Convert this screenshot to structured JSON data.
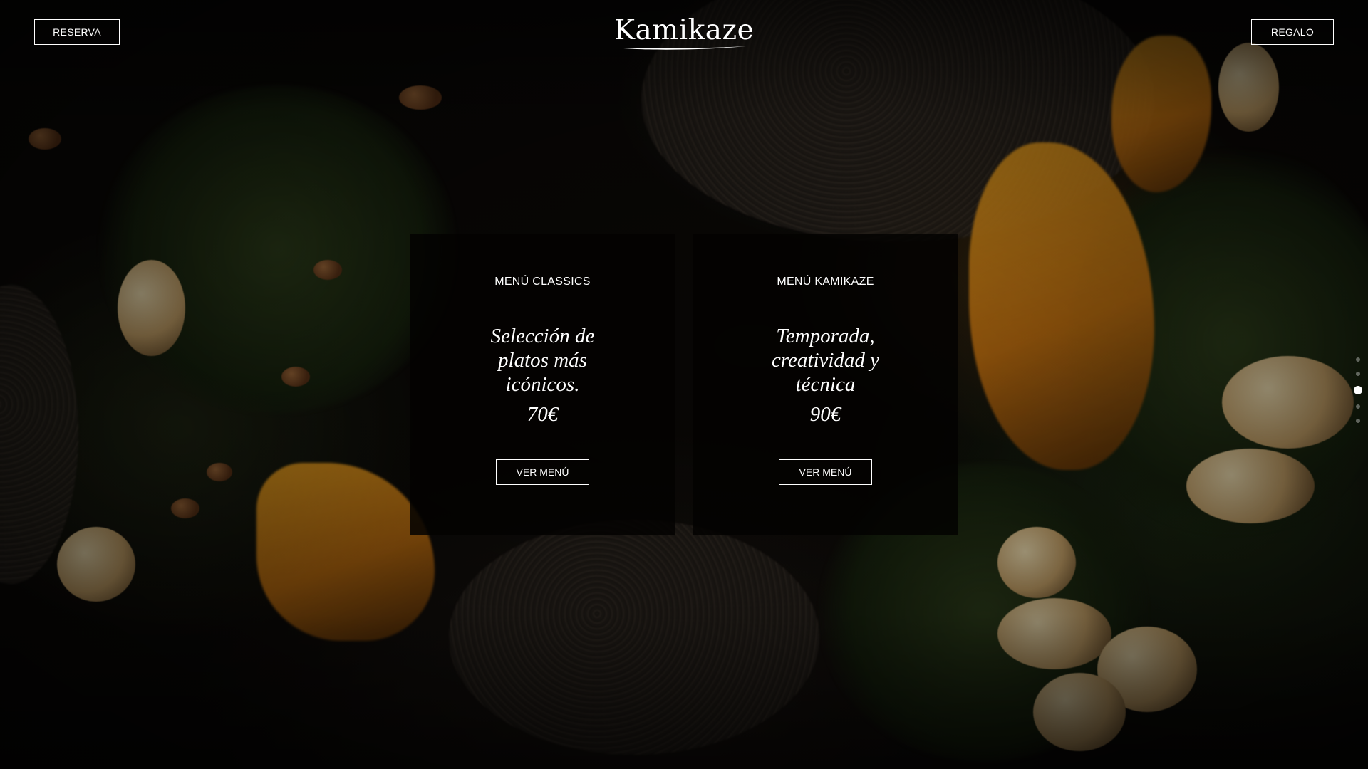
{
  "header": {
    "reserva_label": "RESERVA",
    "regalo_label": "REGALO",
    "logo_text": "Kamikaze"
  },
  "menus": [
    {
      "title": "MENÚ CLASSICS",
      "description": "Selección de platos más icónicos.",
      "price": "70€",
      "button_label": "VER MENÚ"
    },
    {
      "title": "MENÚ KAMIKAZE",
      "description": "Temporada, creatividad y técnica",
      "price": "90€",
      "button_label": "VER MENÚ"
    }
  ],
  "pager": {
    "count": 5,
    "active_index": 2
  },
  "colors": {
    "text": "#ffffff",
    "card_background": "#030201",
    "page_background": "#0b0906"
  },
  "icons": {
    "logo_underline": "swash-underline-icon"
  }
}
